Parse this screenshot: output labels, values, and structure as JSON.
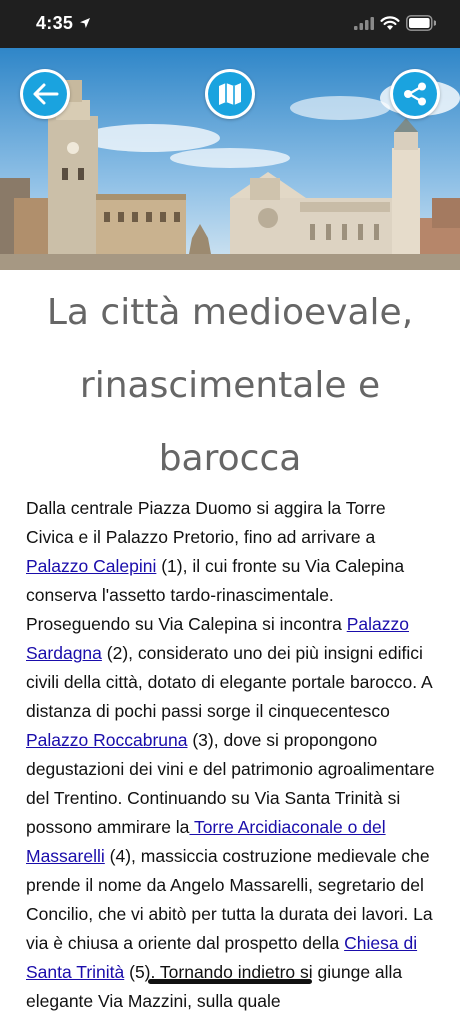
{
  "status_bar": {
    "time": "4:35"
  },
  "header": {
    "back_icon": "arrow-left-icon",
    "map_icon": "map-icon",
    "share_icon": "share-icon",
    "accent_color": "#1aa3df"
  },
  "page": {
    "title": "La città medioevale, rinascimentale e barocca"
  },
  "article": {
    "t1": "Dalla centrale Piazza Duomo si aggira la Torre Civica e il Palazzo Pretorio, fino ad arrivare a ",
    "link1": "Palazzo Calepini",
    "t2": " (1), il cui fronte su Via Calepina conserva l'assetto tardo-rinascimentale. Proseguendo su Via Calepina si incontra ",
    "link2": "Palazzo Sardagna",
    "t3": " (2), considerato uno dei più insigni edifici civili della città, dotato di elegante portale barocco. A distanza di pochi passi sorge il cinquecentesco ",
    "link3": "Palazzo Roccabruna",
    "t4": " (3), dove si propongono degustazioni dei vini e del patrimonio agroalimentare del Trentino. Continuando su Via Santa Trinità si possono ammirare la",
    "link4": " Torre Arcidiaconale o del Massarelli",
    "t5": " (4), massiccia costruzione medievale che prende il nome da Angelo Massarelli, segretario del Concilio, che vi abitò per tutta la durata dei lavori. La via è chiusa a oriente dal prospetto della ",
    "link5": "Chiesa di Santa Trinità",
    "t6": " (5). Tornando indietro si giunge alla elegante Via Mazzini, sulla quale"
  }
}
